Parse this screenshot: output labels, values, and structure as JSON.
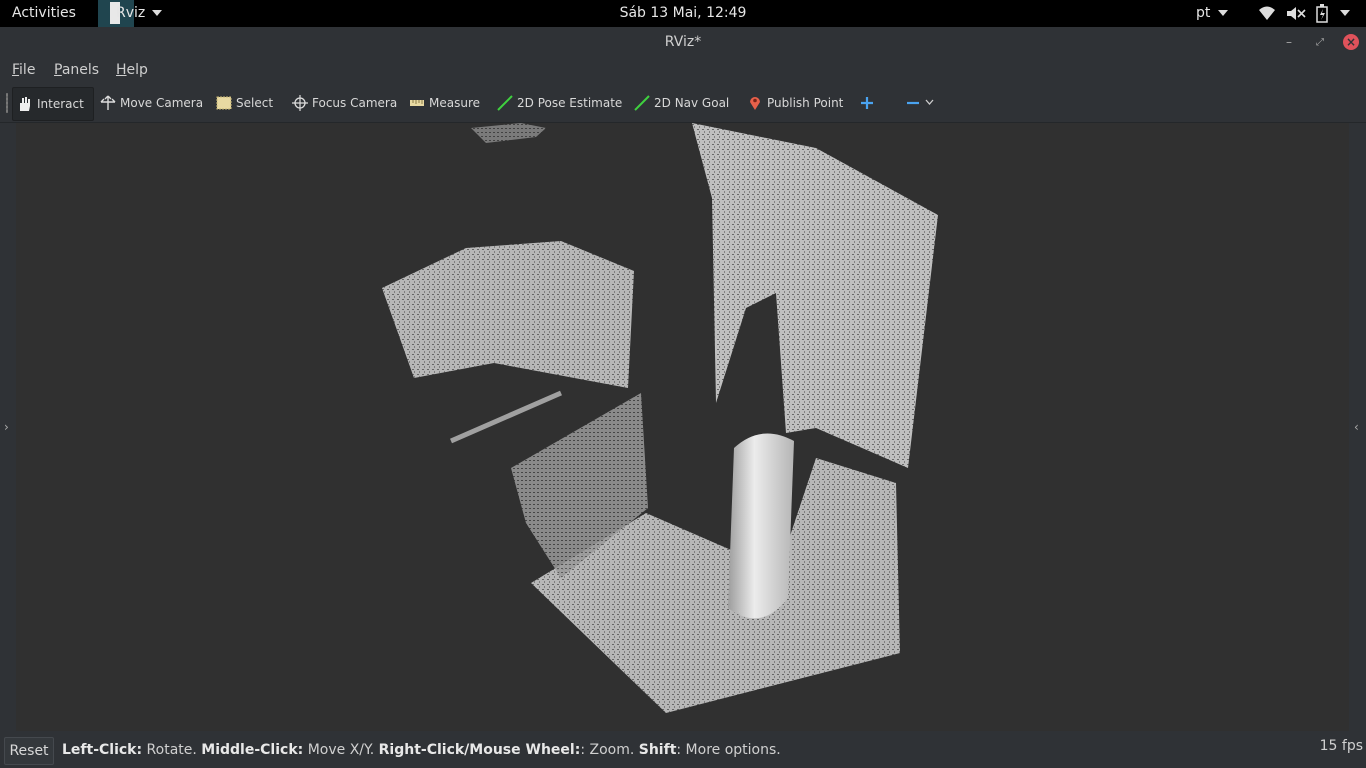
{
  "topbar": {
    "activities": "Activities",
    "app_name": "Rviz",
    "clock": "Sáb 13 Mai, 12:49",
    "language": "pt",
    "icons": [
      "wifi-icon",
      "volume-muted-icon",
      "battery-icon",
      "system-menu-caret-icon"
    ]
  },
  "window": {
    "title": "RViz*"
  },
  "menu": {
    "file": "File",
    "panels": "Panels",
    "help": "Help"
  },
  "toolbar": {
    "interact": "Interact",
    "move_camera": "Move Camera",
    "select": "Select",
    "focus_camera": "Focus Camera",
    "measure": "Measure",
    "pose_estimate": "2D Pose Estimate",
    "nav_goal": "2D Nav Goal",
    "publish_point": "Publish Point",
    "add_tool_icon": "plus-icon",
    "remove_tool_icon": "minus-icon"
  },
  "viewport": {
    "background": "#303030",
    "point_color": "#d9d9d9"
  },
  "status": {
    "reset": "Reset",
    "hint_left_key": "Left-Click:",
    "hint_left_val": " Rotate. ",
    "hint_middle_key": "Middle-Click:",
    "hint_middle_val": " Move X/Y. ",
    "hint_right_key": "Right-Click/Mouse Wheel:",
    "hint_right_val": ": Zoom. ",
    "hint_shift_key": "Shift",
    "hint_shift_val": ": More options.",
    "fps": "15 fps"
  },
  "colors": {
    "accent_green": "#3fd13f",
    "publish_point_red": "#e8604a",
    "add_blue": "#4aa3f0",
    "close_red": "#e0525b"
  }
}
